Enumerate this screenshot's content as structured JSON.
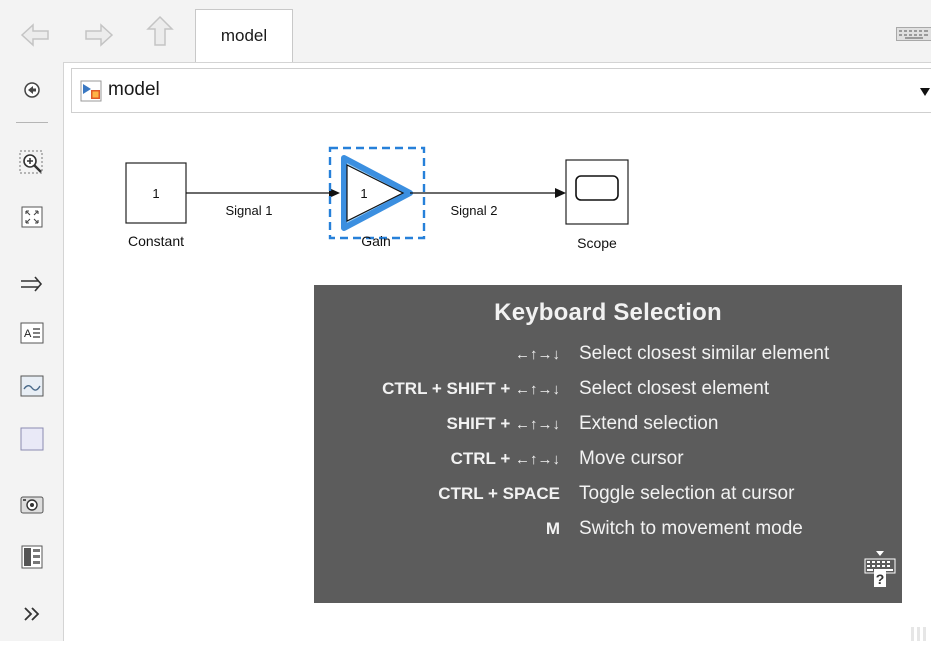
{
  "tab": {
    "label": "model"
  },
  "address": {
    "path": "model"
  },
  "blocks": {
    "constant": {
      "value": "1",
      "name": "Constant"
    },
    "gain": {
      "value": "1",
      "name": "Gain"
    },
    "scope": {
      "name": "Scope"
    }
  },
  "signals": {
    "signal1": "Signal 1",
    "signal2": "Signal 2"
  },
  "keyboard_selection": {
    "title": "Keyboard Selection",
    "rows": [
      {
        "modifier": "",
        "arrows": "←↑→↓",
        "desc": "Select closest similar element"
      },
      {
        "modifier": "CTRL + SHIFT + ",
        "arrows": "←↑→↓",
        "desc": "Select closest element"
      },
      {
        "modifier": "SHIFT + ",
        "arrows": "←↑→↓",
        "desc": "Extend selection"
      },
      {
        "modifier": "CTRL + ",
        "arrows": "←↑→↓",
        "desc": "Move cursor"
      },
      {
        "modifier": "CTRL + SPACE",
        "arrows": "",
        "desc": "Toggle selection at cursor"
      },
      {
        "modifier": "M",
        "arrows": "",
        "desc": "Switch to movement mode"
      }
    ]
  },
  "toolbar": {
    "left_tools": [
      "hide-explorer-icon",
      "zoom-icon",
      "fit-to-view-icon",
      "route-lines-icon",
      "annotation-icon",
      "image-icon",
      "area-icon",
      "screenshot-icon",
      "model-browser-icon",
      "more-icon"
    ],
    "nav": [
      "back-icon",
      "forward-icon",
      "up-icon"
    ]
  },
  "colors": {
    "selection": "#2680d9",
    "highlight": "#9ccdf2",
    "panel": "#5c5c5c"
  }
}
